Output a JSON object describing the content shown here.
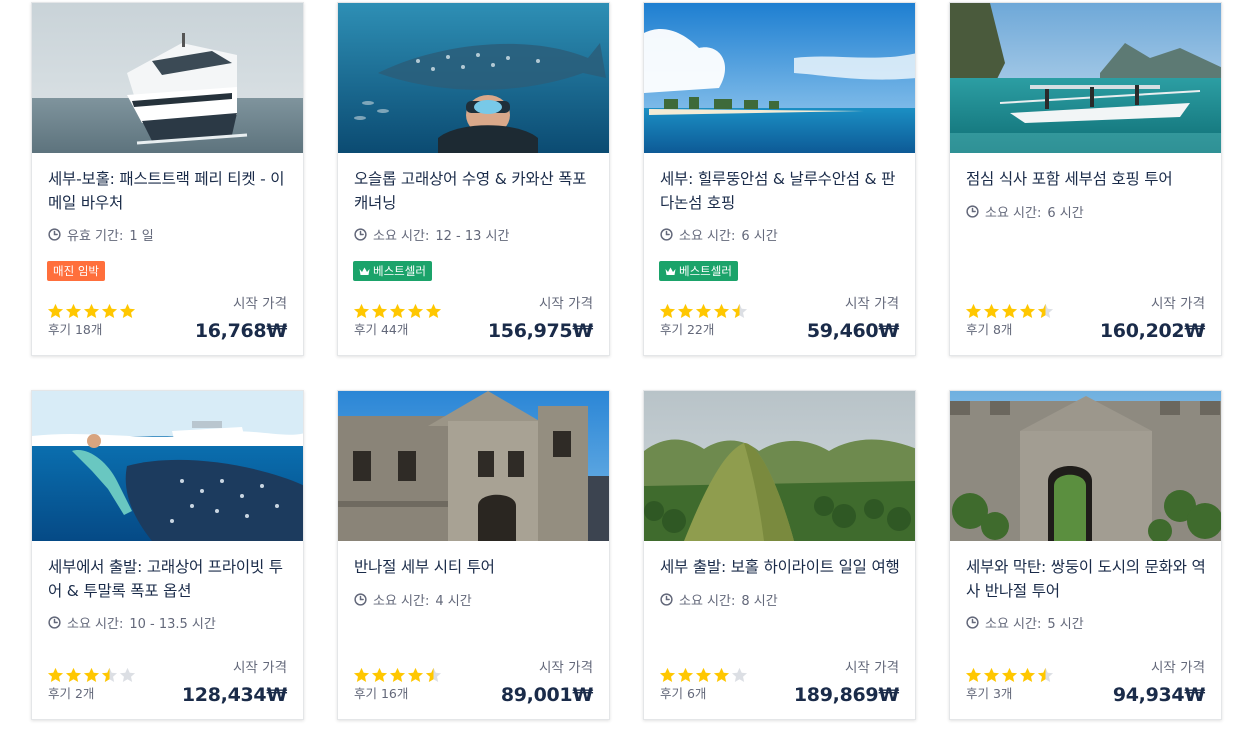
{
  "cards": [
    {
      "title": "세부-보홀: 패스트트랙 페리 티켓 - 이메일 바우처",
      "duration_label": "유효 기간:",
      "duration_value": "1 일",
      "badge": "매진 임박",
      "badge_color": "#ff6f3c",
      "rating": 5,
      "reviews": "후기 18개",
      "price_label": "시작 가격",
      "price": "16,768₩",
      "image": "ferry"
    },
    {
      "title": "오슬롭 고래상어 수영 & 카와산 폭포 캐녀닝",
      "duration_label": "소요 시간:",
      "duration_value": "12 - 13 시간",
      "badge": "베스트셀러",
      "badge_color": "#1ba36a",
      "rating": 5,
      "reviews": "후기 44개",
      "price_label": "시작 가격",
      "price": "156,975₩",
      "image": "underwater"
    },
    {
      "title": "세부: 힐루뚱안섬 & 날루수안섬 & 판다논섬 호핑",
      "duration_label": "소요 시간:",
      "duration_value": "6 시간",
      "badge": "베스트셀러",
      "badge_color": "#1ba36a",
      "rating": 4.5,
      "reviews": "후기 22개",
      "price_label": "시작 가격",
      "price": "59,460₩",
      "image": "island"
    },
    {
      "title": "점심 식사 포함 세부섬 호핑 투어",
      "duration_label": "소요 시간:",
      "duration_value": "6 시간",
      "badge": "",
      "rating": 4.5,
      "reviews": "후기 8개",
      "price_label": "시작 가격",
      "price": "160,202₩",
      "image": "boat"
    },
    {
      "title": "세부에서 출발: 고래상어 프라이빗 투어 & 투말록 폭포 옵션",
      "duration_label": "소요 시간:",
      "duration_value": "10 - 13.5 시간",
      "badge": "",
      "rating": 3.5,
      "reviews": "후기 2개",
      "price_label": "시작 가격",
      "price": "128,434₩",
      "image": "whaleshark"
    },
    {
      "title": "반나절 세부 시티 투어",
      "duration_label": "소요 시간:",
      "duration_value": "4 시간",
      "badge": "",
      "rating": 4.5,
      "reviews": "후기 16개",
      "price_label": "시작 가격",
      "price": "89,001₩",
      "image": "church"
    },
    {
      "title": "세부 출발: 보홀 하이라이트 일일 여행",
      "duration_label": "소요 시간:",
      "duration_value": "8 시간",
      "badge": "",
      "rating": 4,
      "reviews": "후기 6개",
      "price_label": "시작 가격",
      "price": "189,869₩",
      "image": "hills"
    },
    {
      "title": "세부와 막탄: 쌍둥이 도시의 문화와 역사 반나절 투어",
      "duration_label": "소요 시간:",
      "duration_value": "5 시간",
      "badge": "",
      "rating": 4.5,
      "reviews": "후기 3개",
      "price_label": "시작 가격",
      "price": "94,934₩",
      "image": "fort"
    }
  ],
  "colors": {
    "star": "#ffc700",
    "star_empty": "#dcdfe4",
    "text": "#1a2b49",
    "muted": "#63687a"
  },
  "icons": {
    "duration": "clock-icon",
    "bestseller": "crown-icon",
    "rating": "star-icon"
  }
}
